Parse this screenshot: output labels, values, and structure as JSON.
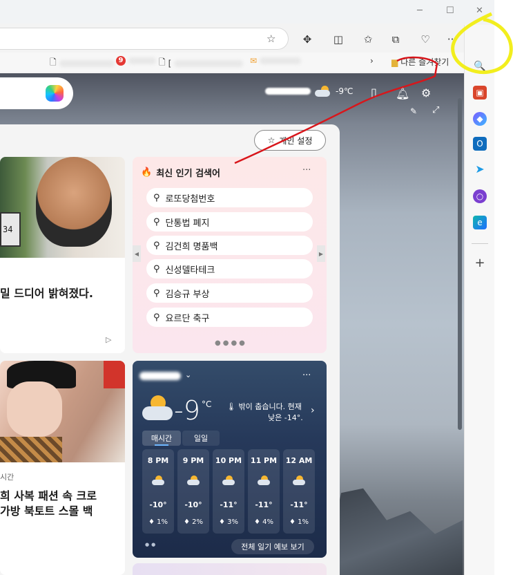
{
  "browser": {
    "bookmarks": [
      {
        "label": "",
        "icon": "page-icon"
      },
      {
        "label": "9",
        "icon": "red-badge-icon"
      },
      {
        "label": "[",
        "icon": "page-icon"
      },
      {
        "label": "",
        "icon": "mail-icon"
      }
    ],
    "bookmarks_other": "다른 즐겨찾기"
  },
  "header": {
    "temperature": "-9℃"
  },
  "feed": {
    "personalize_label": "개인 설정",
    "news1": {
      "headline": "밀 드디어 밝혀졌다.",
      "device_text": "34"
    },
    "news2": {
      "meta": "시간",
      "headline_line1": "희 사복 패션 속 크로",
      "headline_line2": "가방 북토트 스몰 백"
    }
  },
  "trending": {
    "title": "최신 인기 검색어",
    "items": [
      "로또당첨번호",
      "단통법 폐지",
      "김건희 명품백",
      "신성델타테크",
      "김승규 부상",
      "요르단 축구"
    ]
  },
  "weather": {
    "temp": "-9",
    "unit": "°C",
    "summary_line1": "밖이 춥습니다. 현재",
    "summary_line2": "낮은 -14°.",
    "tabs": [
      "매시간",
      "일일"
    ],
    "hours": [
      {
        "time": "8 PM",
        "temp": "-10°",
        "precip": "1%"
      },
      {
        "time": "9 PM",
        "temp": "-10°",
        "precip": "2%"
      },
      {
        "time": "10 PM",
        "temp": "-11°",
        "precip": "3%"
      },
      {
        "time": "11 PM",
        "temp": "-11°",
        "precip": "4%"
      },
      {
        "time": "12 AM",
        "temp": "-11°",
        "precip": "1%"
      }
    ],
    "forecast_button": "전체 일기 예보 보기"
  },
  "colors": {
    "annotation_red": "#d8161b",
    "annotation_yellow": "#f2ee1e",
    "copilot_blue": "#1f6fff"
  }
}
